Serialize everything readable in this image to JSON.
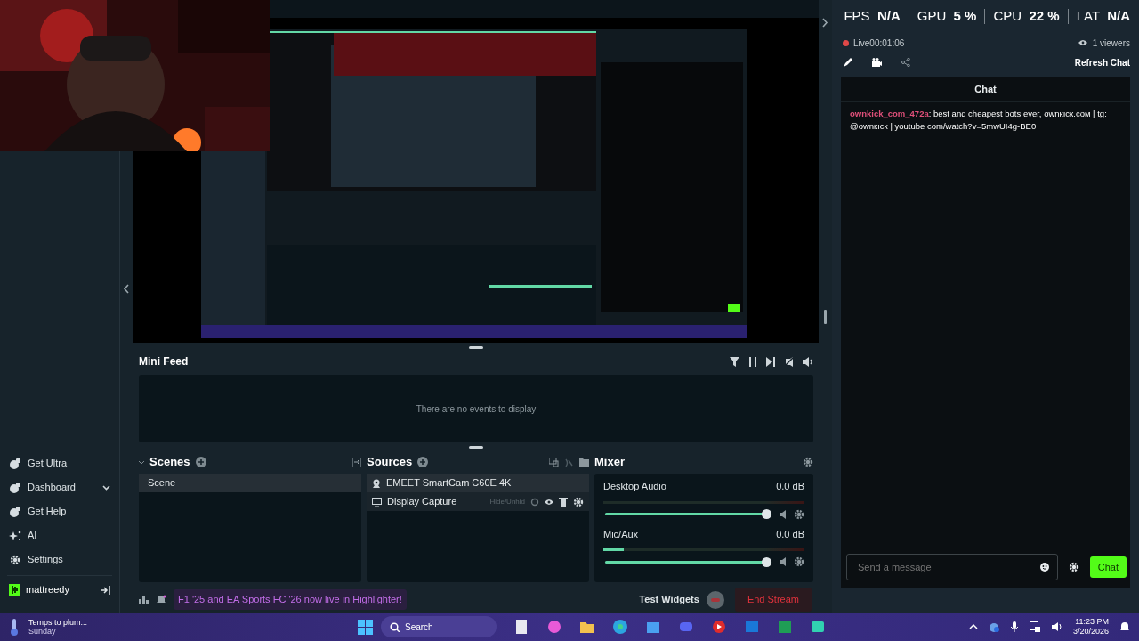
{
  "stats": [
    {
      "label": "FPS",
      "value": "N/A"
    },
    {
      "label": "GPU",
      "value": "5 %"
    },
    {
      "label": "CPU",
      "value": "22 %"
    },
    {
      "label": "LAT",
      "value": "N/A"
    }
  ],
  "stream": {
    "live_label": "Live",
    "time": "00:01:06",
    "viewers": "1 viewers",
    "refresh": "Refresh Chat"
  },
  "chat": {
    "title": "Chat",
    "messages": [
      {
        "user": "ownkick_com_472a",
        "text": ": best and cheapest bots ever, ownкıcк.coм | tg: @ownкıcк | youtube com/watch?v=5mwUI4g-BE0"
      }
    ],
    "placeholder": "Send a message",
    "send": "Chat"
  },
  "sidebar": {
    "items": [
      {
        "label": "Get Ultra",
        "kind": "ultra",
        "collapsible": false
      },
      {
        "label": "Dashboard",
        "kind": "dashboard",
        "collapsible": true
      },
      {
        "label": "Get Help",
        "kind": "help",
        "collapsible": false
      },
      {
        "label": "AI",
        "kind": "ai",
        "collapsible": false
      },
      {
        "label": "Settings",
        "kind": "settings",
        "collapsible": false
      }
    ],
    "user": "mattreedy"
  },
  "mini_feed": {
    "title": "Mini Feed",
    "empty": "There are no events to display"
  },
  "scenes": {
    "title": "Scenes",
    "items": [
      {
        "label": "Scene",
        "selected": true
      }
    ]
  },
  "sources": {
    "title": "Sources",
    "items": [
      {
        "label": "EMEET SmartCam C60E 4K",
        "kind": "camera",
        "selected": true
      },
      {
        "label": "Display Capture",
        "kind": "display",
        "selected": false,
        "tooltip": "Hide/Unhid"
      }
    ]
  },
  "mixer": {
    "title": "Mixer",
    "channels": [
      {
        "name": "Desktop Audio",
        "reading": "0.0 dB",
        "meter": {
          "level": 0
        },
        "volume": {
          "level": 1
        }
      },
      {
        "name": "Mic/Aux",
        "reading": "0.0 dB",
        "meter": {
          "level": 0.1
        },
        "volume": {
          "level": 1
        }
      }
    ]
  },
  "notification": "F1 '25 and EA Sports FC '26 now live in Highlighter!",
  "footer": {
    "test_widgets": "Test Widgets",
    "end_stream": "End Stream"
  },
  "taskbar": {
    "weather_title": "Temps to plum...",
    "weather_day": "Sunday",
    "search": "Search",
    "time": "11:23 PM",
    "date": "3/20/2026"
  }
}
